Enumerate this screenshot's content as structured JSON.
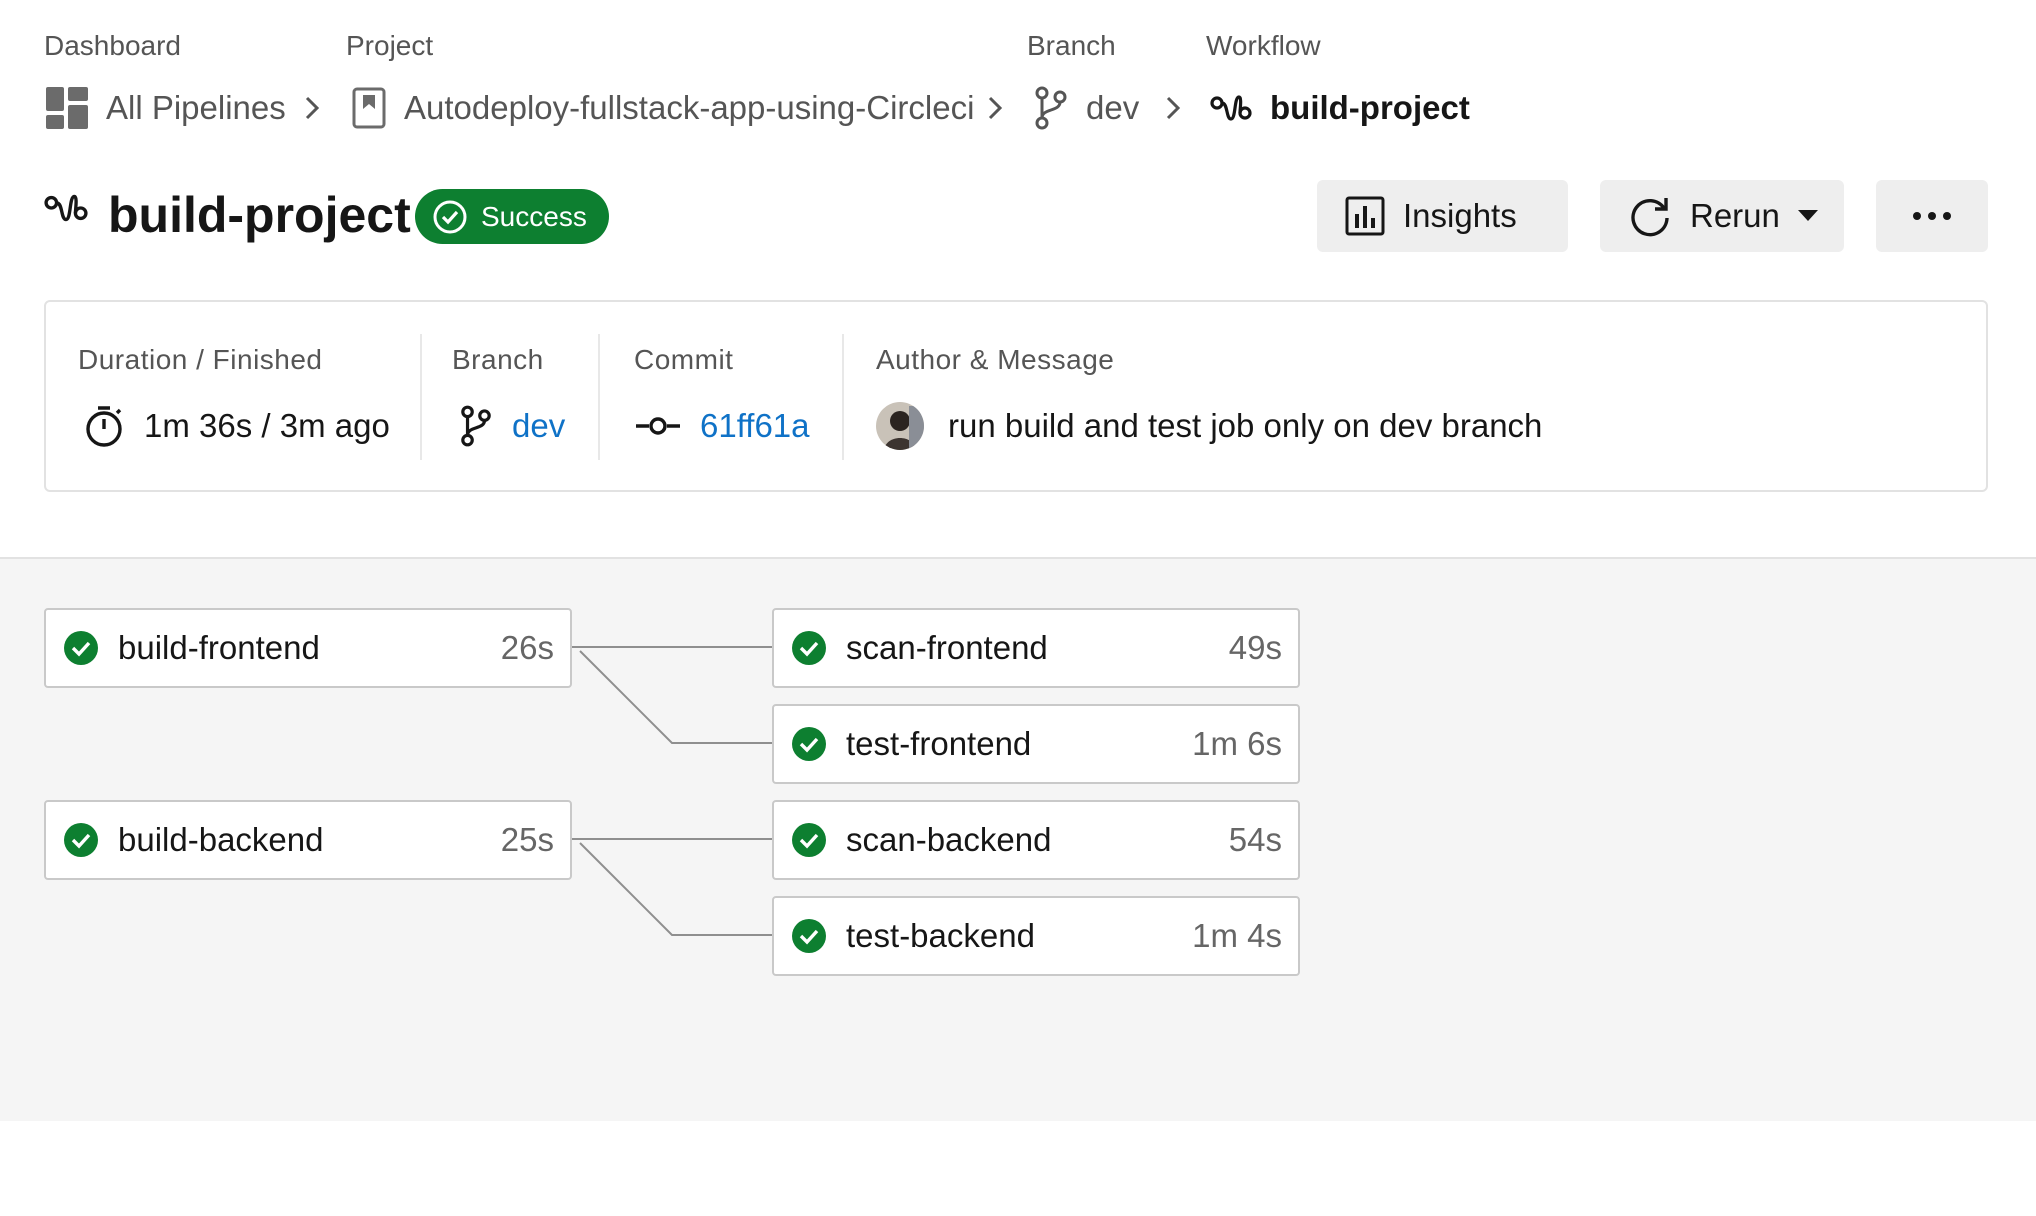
{
  "breadcrumbs": {
    "labels": {
      "dashboard": "Dashboard",
      "project": "Project",
      "branch": "Branch",
      "workflow": "Workflow"
    },
    "items": {
      "dashboard": "All Pipelines",
      "project": "Autodeploy-fullstack-app-using-Circleci",
      "branch": "dev",
      "workflow": "build-project"
    }
  },
  "header": {
    "title": "build-project",
    "status": "Success",
    "buttons": {
      "insights": "Insights",
      "rerun": "Rerun"
    }
  },
  "summary": {
    "duration": {
      "label": "Duration / Finished",
      "value": "1m 36s / 3m ago"
    },
    "branch": {
      "label": "Branch",
      "value": "dev"
    },
    "commit": {
      "label": "Commit",
      "value": "61ff61a"
    },
    "author": {
      "label": "Author & Message",
      "message": "run build and test job only on dev branch"
    }
  },
  "jobs": [
    {
      "name": "build-frontend",
      "duration": "26s",
      "status": "success"
    },
    {
      "name": "scan-frontend",
      "duration": "49s",
      "status": "success"
    },
    {
      "name": "test-frontend",
      "duration": "1m 6s",
      "status": "success"
    },
    {
      "name": "build-backend",
      "duration": "25s",
      "status": "success"
    },
    {
      "name": "scan-backend",
      "duration": "54s",
      "status": "success"
    },
    {
      "name": "test-backend",
      "duration": "1m 4s",
      "status": "success"
    }
  ],
  "colors": {
    "success": "#0d7f30",
    "link": "#0f72c7",
    "text": "#161616",
    "muted": "#555555"
  },
  "icons": {
    "dashboard": "dashboard-grid-icon",
    "project": "bookmark-icon",
    "branch": "git-branch-icon",
    "workflow": "workflow-icon",
    "timer": "stopwatch-icon",
    "commit": "git-commit-icon",
    "success": "check-circle-icon",
    "insights": "bar-chart-icon",
    "rerun": "refresh-icon",
    "more": "ellipsis-icon"
  }
}
